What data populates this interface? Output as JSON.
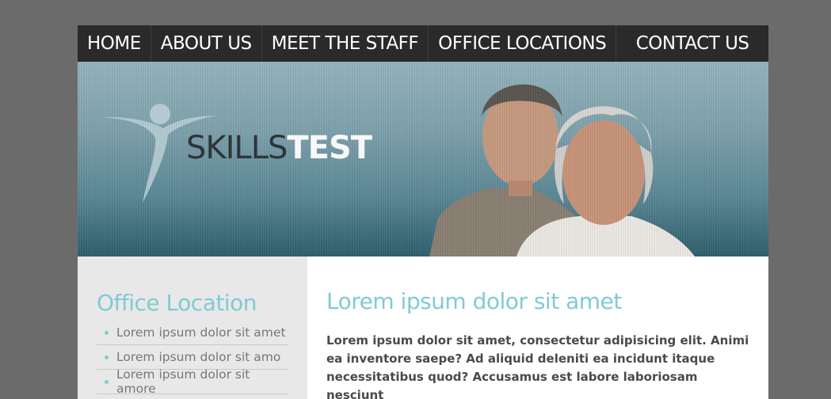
{
  "nav": {
    "items": [
      {
        "label": "HOME"
      },
      {
        "label": "ABOUT US"
      },
      {
        "label": "MEET THE STAFF"
      },
      {
        "label": "OFFICE LOCATIONS"
      },
      {
        "label": "CONTACT US"
      }
    ]
  },
  "hero": {
    "logo_word1": "SKILLS",
    "logo_word2": "TEST"
  },
  "sidebar": {
    "title": "Office Location",
    "items": [
      {
        "label": "Lorem ipsum dolor sit amet"
      },
      {
        "label": "Lorem ipsum dolor sit amo"
      },
      {
        "label": "Lorem ipsum dolor sit amore"
      }
    ]
  },
  "main": {
    "title": "Lorem ipsum dolor sit amet",
    "body": "Lorem ipsum dolor sit amet, consectetur adipisicing elit. Animi ea inventore saepe? Ad aliquid deleniti ea incidunt itaque necessitatibus quod? Accusamus est labore laboriosam nesciunt"
  },
  "colors": {
    "background": "#6b6b6b",
    "nav_bg": "#2a2a2a",
    "accent": "#7fcbd5",
    "sidebar_bg": "#e8e8e8"
  }
}
